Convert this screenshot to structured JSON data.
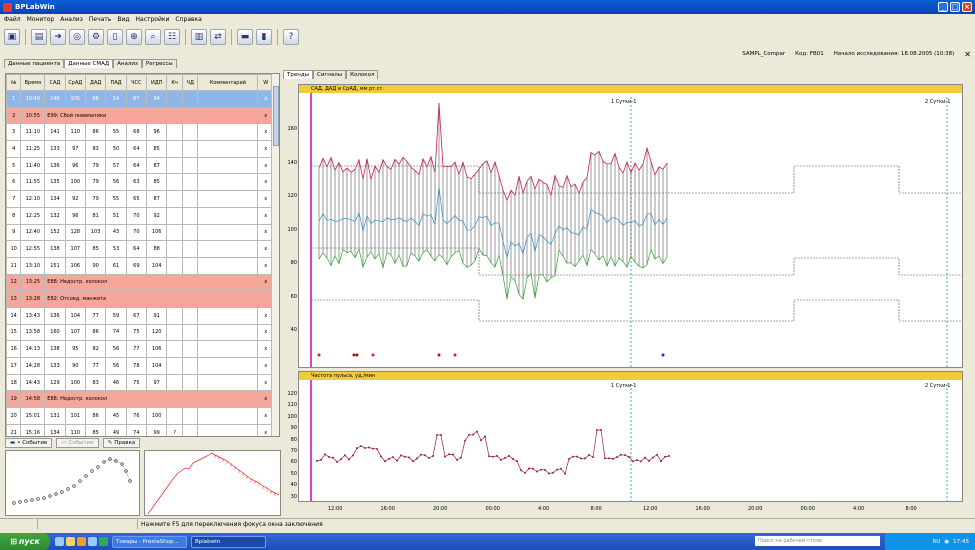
{
  "window": {
    "title": "BPLabWin"
  },
  "menu": [
    "Файл",
    "Монитор",
    "Анализ",
    "Печать",
    "Вид",
    "Настройки",
    "Справка"
  ],
  "toolbar_icons": [
    "save-icon",
    "open-icon",
    "export-icon",
    "monitor-icon",
    "settings-icon",
    "print-preview-icon",
    "zoom-icon",
    "search-icon",
    "table-icon",
    "chart-icon",
    "compare-icon",
    "device-icon",
    "device2-icon",
    "help-icon"
  ],
  "info": {
    "patient": "SAMPL_Compar",
    "code": "Код: FB01",
    "start": "Начало исследования: 18.08.2005 (10:38)"
  },
  "tabs": [
    "Данные пациента",
    "Данные СМАД",
    "Анализ",
    "Регрессы"
  ],
  "table": {
    "headers": [
      "№",
      "Время",
      "САД",
      "СрАД",
      "ДАД",
      "ПАД",
      "ЧСС",
      "ИДП",
      "Кч",
      "ЧД",
      "Комментарий",
      "W"
    ],
    "rows": [
      {
        "n": "1",
        "t": "10:40",
        "v": [
          "140",
          "105",
          "86",
          "54",
          "67",
          "94"
        ],
        "w": "x",
        "type": "sel"
      },
      {
        "n": "2",
        "t": "10:55",
        "msg": "E99: Сбой пневматики",
        "w": "x",
        "type": "evt"
      },
      {
        "n": "3",
        "t": "11:10",
        "v": [
          "141",
          "110",
          "86",
          "55",
          "68",
          "96"
        ],
        "w": "x"
      },
      {
        "n": "4",
        "t": "11:25",
        "v": [
          "133",
          "97",
          "83",
          "50",
          "64",
          "85"
        ],
        "w": "x"
      },
      {
        "n": "5",
        "t": "11:40",
        "v": [
          "136",
          "96",
          "79",
          "57",
          "64",
          "87"
        ],
        "w": "x"
      },
      {
        "n": "6",
        "t": "11:55",
        "v": [
          "135",
          "100",
          "79",
          "56",
          "63",
          "85"
        ],
        "w": "x"
      },
      {
        "n": "7",
        "t": "12:10",
        "v": [
          "134",
          "92",
          "79",
          "55",
          "65",
          "87"
        ],
        "w": "x"
      },
      {
        "n": "8",
        "t": "12:25",
        "v": [
          "132",
          "96",
          "81",
          "51",
          "70",
          "92"
        ],
        "w": "x"
      },
      {
        "n": "9",
        "t": "12:40",
        "v": [
          "152",
          "128",
          "103",
          "43",
          "70",
          "106"
        ],
        "w": "x"
      },
      {
        "n": "10",
        "t": "12:55",
        "v": [
          "138",
          "107",
          "85",
          "53",
          "64",
          "88"
        ],
        "w": "x"
      },
      {
        "n": "11",
        "t": "13:10",
        "v": [
          "151",
          "106",
          "90",
          "61",
          "69",
          "104"
        ],
        "w": "x"
      },
      {
        "n": "12",
        "t": "13:25",
        "msg": "E88: Недостр. колокол",
        "w": "x",
        "type": "evt"
      },
      {
        "n": "13",
        "t": "13:28",
        "msg": "E82: Отсоед. манжета",
        "w": "",
        "type": "evt"
      },
      {
        "n": "14",
        "t": "13:43",
        "v": [
          "136",
          "104",
          "77",
          "59",
          "67",
          "91"
        ],
        "w": "x"
      },
      {
        "n": "15",
        "t": "13:58",
        "v": [
          "160",
          "107",
          "86",
          "74",
          "75",
          "120"
        ],
        "w": "x"
      },
      {
        "n": "16",
        "t": "14:13",
        "v": [
          "138",
          "95",
          "82",
          "56",
          "77",
          "106"
        ],
        "w": "x"
      },
      {
        "n": "17",
        "t": "14:28",
        "v": [
          "133",
          "90",
          "77",
          "56",
          "78",
          "104"
        ],
        "w": "x"
      },
      {
        "n": "18",
        "t": "14:43",
        "v": [
          "129",
          "100",
          "83",
          "46",
          "75",
          "97"
        ],
        "w": "x"
      },
      {
        "n": "19",
        "t": "14:58",
        "msg": "E88: Недостр. колокол",
        "w": "x",
        "type": "evt"
      },
      {
        "n": "20",
        "t": "15:01",
        "v": [
          "131",
          "101",
          "86",
          "45",
          "76",
          "100"
        ],
        "w": "x"
      },
      {
        "n": "21",
        "t": "15:16",
        "v": [
          "134",
          "110",
          "85",
          "49",
          "74",
          "99"
        ],
        "kch": "?",
        "w": "x"
      }
    ]
  },
  "event_buttons": {
    "add": "• Событие",
    "remove": "Событие",
    "edit": "Правка"
  },
  "right_tabs": [
    "Тренды",
    "Сигналы",
    "Колокол"
  ],
  "bp_panel": {
    "title": "САД, ДАД и СрАД, мм рт.ст.",
    "yticks": [
      "160",
      "140",
      "120",
      "100",
      "80",
      "60",
      "40"
    ],
    "markers": [
      "1 Сутки-1",
      "2 Сутки-1"
    ]
  },
  "hr_panel": {
    "title": "Частота пульса, уд./мин",
    "yticks": [
      "120",
      "110",
      "100",
      "90",
      "80",
      "70",
      "60",
      "50",
      "40",
      "30"
    ],
    "markers": [
      "1 Сутки-1",
      "2 Сутки-1"
    ]
  },
  "x_ticks": [
    "12:00",
    "16:00",
    "20:00",
    "00:00",
    "4:00",
    "8:00",
    "12:00",
    "16:00",
    "20:00",
    "00:00",
    "4:00",
    "8:00"
  ],
  "status": {
    "message": "Нажмите F5 для переключения фокуса окна заключения"
  },
  "taskbar": {
    "start": "пуск",
    "tasks": [
      "Товары - PrestaShop...",
      "Bplabwin"
    ],
    "deskbar": "Поиск на рабочем столе",
    "lang": "RU",
    "clock": "17:45"
  },
  "colors": {
    "sad": "#c8214a",
    "srad": "#2f8fd1",
    "dad": "#2fa52f",
    "hr": "#9a1f4a",
    "selected_row": "#8eb6e8",
    "event_row": "#f7a69a",
    "panel_title": "#f0cc3a"
  }
}
